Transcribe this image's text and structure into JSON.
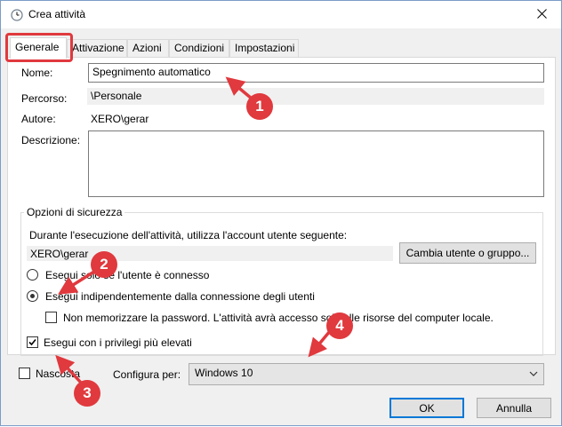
{
  "window": {
    "title": "Crea attività",
    "title_icon": "clock-icon",
    "close_icon": "close-icon"
  },
  "tabs": [
    {
      "label": "Generale",
      "active": true
    },
    {
      "label": "Attivazione"
    },
    {
      "label": "Azioni"
    },
    {
      "label": "Condizioni"
    },
    {
      "label": "Impostazioni"
    }
  ],
  "general": {
    "name_label": "Nome:",
    "name_value": "Spegnimento automatico",
    "path_label": "Percorso:",
    "path_value": "\\Personale",
    "author_label": "Autore:",
    "author_value": "XERO\\gerar",
    "description_label": "Descrizione:",
    "description_value": ""
  },
  "security": {
    "legend": "Opzioni di sicurezza",
    "account_text": "Durante l'esecuzione dell'attività, utilizza l'account utente seguente:",
    "user_value": "XERO\\gerar",
    "change_user_button": "Cambia utente o gruppo...",
    "radio_logged_on": "Esegui solo se l'utente è connesso",
    "radio_logged_on_selected": false,
    "radio_independent": "Esegui indipendentemente dalla connessione degli utenti",
    "radio_independent_selected": true,
    "no_store_password": "Non memorizzare la password. L'attività avrà accesso solo alle risorse del computer locale.",
    "no_store_password_checked": false,
    "highest_privileges": "Esegui con i privilegi più elevati",
    "highest_privileges_checked": true
  },
  "footer": {
    "hidden_label": "Nascosta",
    "hidden_checked": false,
    "configure_label": "Configura per:",
    "configure_value": "Windows 10",
    "ok_button": "OK",
    "cancel_button": "Annulla"
  },
  "annotations": {
    "badges": [
      "1",
      "2",
      "3",
      "4"
    ],
    "accent_color": "#e0393e"
  }
}
